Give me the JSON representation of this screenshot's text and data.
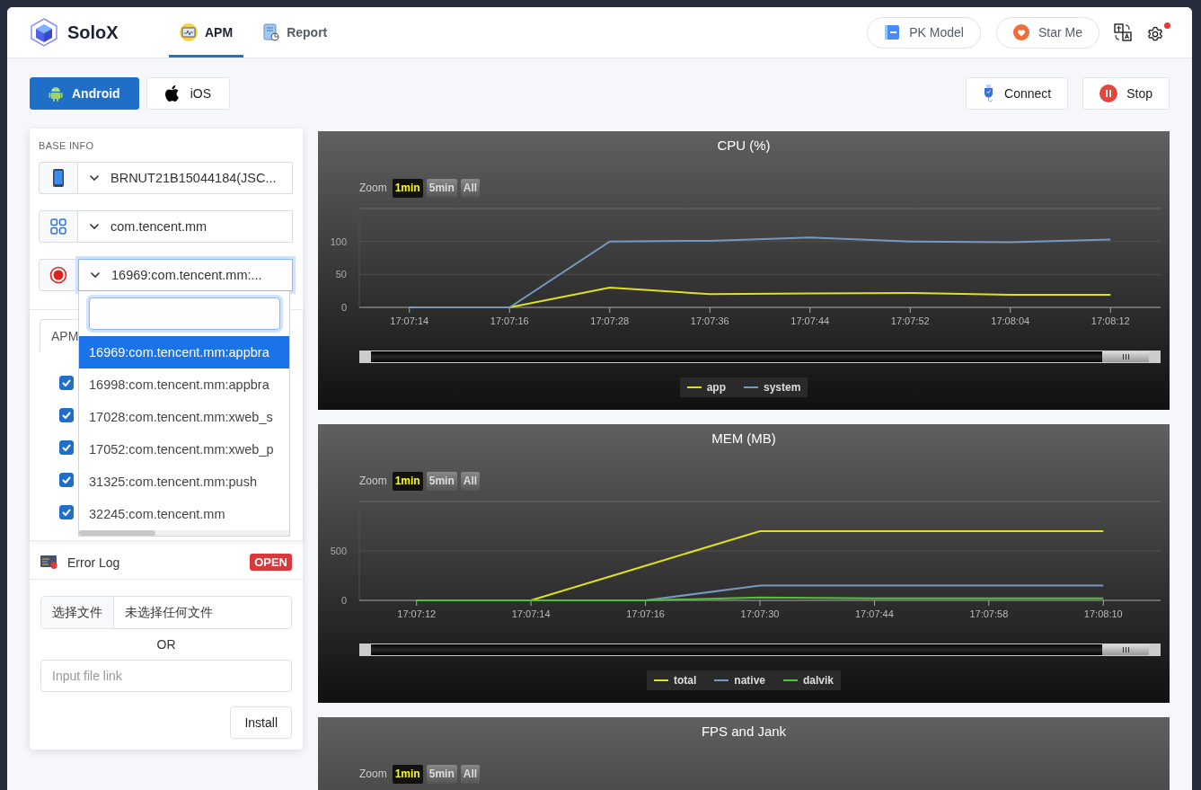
{
  "header": {
    "logo": "SoloX",
    "tabs": [
      {
        "label": "APM",
        "selected": true
      },
      {
        "label": "Report",
        "selected": false
      }
    ],
    "pk_button": "PK Model",
    "star_button": "Star Me",
    "settings_notification": true
  },
  "platforms": [
    {
      "label": "Android",
      "selected": true
    },
    {
      "label": "iOS",
      "selected": false
    }
  ],
  "actions": {
    "connect": "Connect",
    "stop": "Stop"
  },
  "base_info": {
    "title": "BASE INFO",
    "selects": [
      {
        "kind": "device",
        "value": "BRNUT21B15044184(JSC...",
        "focused": false
      },
      {
        "kind": "package",
        "value": "com.tencent.mm",
        "focused": false
      },
      {
        "kind": "process",
        "value": "16969:com.tencent.mm:...",
        "focused": true,
        "dropdown": {
          "options": [
            {
              "label": "16969:com.tencent.mm:appbra",
              "selected": true
            },
            {
              "label": "16998:com.tencent.mm:appbra",
              "selected": false
            },
            {
              "label": "17028:com.tencent.mm:xweb_s",
              "selected": false
            },
            {
              "label": "17052:com.tencent.mm:xweb_p",
              "selected": false
            },
            {
              "label": "31325:com.tencent.mm:push",
              "selected": false
            },
            {
              "label": "32245:com.tencent.mm",
              "selected": false
            }
          ]
        }
      }
    ]
  },
  "metrics_card": {
    "tab": {
      "label": "APM",
      "selected": true
    },
    "checkboxes": [
      {
        "checked": true
      },
      {
        "checked": true
      },
      {
        "checked": true
      },
      {
        "checked": true
      },
      {
        "checked": true
      }
    ]
  },
  "error_log": {
    "label": "Error Log",
    "badge": "OPEN"
  },
  "install": {
    "file_button": "选择文件",
    "file_status": "未选择任何文件",
    "separator": "OR",
    "link_placeholder": "Input file link",
    "button": "Install"
  },
  "charts": [
    {
      "title": "CPU (%)",
      "zoom_label": "Zoom",
      "zoom_buttons": [
        {
          "label": "1min",
          "selected": true
        },
        {
          "label": "5min",
          "selected": false
        },
        {
          "label": "All",
          "selected": false
        }
      ],
      "chart_data": {
        "type": "line",
        "categories": [
          "17:07:14",
          "17:07:16",
          "17:07:28",
          "17:07:36",
          "17:07:44",
          "17:07:52",
          "17:08:04",
          "17:08:12"
        ],
        "ylim": [
          0,
          150
        ],
        "yticks": [
          0,
          50,
          100
        ],
        "series": [
          {
            "name": "app",
            "color": "#e0e020",
            "values": [
              0,
              0,
              30,
              20,
              21,
              22,
              19,
              19
            ]
          },
          {
            "name": "system",
            "color": "#7798bf",
            "values": [
              0,
              0,
              100,
              101,
              106,
              100,
              99,
              103
            ]
          }
        ]
      }
    },
    {
      "title": "MEM (MB)",
      "zoom_label": "Zoom",
      "zoom_buttons": [
        {
          "label": "1min",
          "selected": true
        },
        {
          "label": "5min",
          "selected": false
        },
        {
          "label": "All",
          "selected": false
        }
      ],
      "chart_data": {
        "type": "line",
        "categories": [
          "17:07:12",
          "17:07:14",
          "17:07:16",
          "17:07:30",
          "17:07:44",
          "17:07:58",
          "17:08:10"
        ],
        "ylim": [
          0,
          1000
        ],
        "yticks": [
          0,
          500
        ],
        "series": [
          {
            "name": "total",
            "color": "#e0e020",
            "values": [
              0,
              0,
              350,
              700,
              700,
              700,
              700
            ]
          },
          {
            "name": "native",
            "color": "#7798bf",
            "values": [
              0,
              0,
              0,
              150,
              150,
              150,
              150
            ]
          },
          {
            "name": "dalvik",
            "color": "#55bf3b",
            "values": [
              0,
              0,
              0,
              30,
              20,
              20,
              20
            ]
          }
        ]
      }
    },
    {
      "title": "FPS and Jank",
      "zoom_label": "Zoom",
      "zoom_buttons": [
        {
          "label": "1min",
          "selected": true
        },
        {
          "label": "5min",
          "selected": false
        },
        {
          "label": "All",
          "selected": false
        }
      ]
    }
  ]
}
